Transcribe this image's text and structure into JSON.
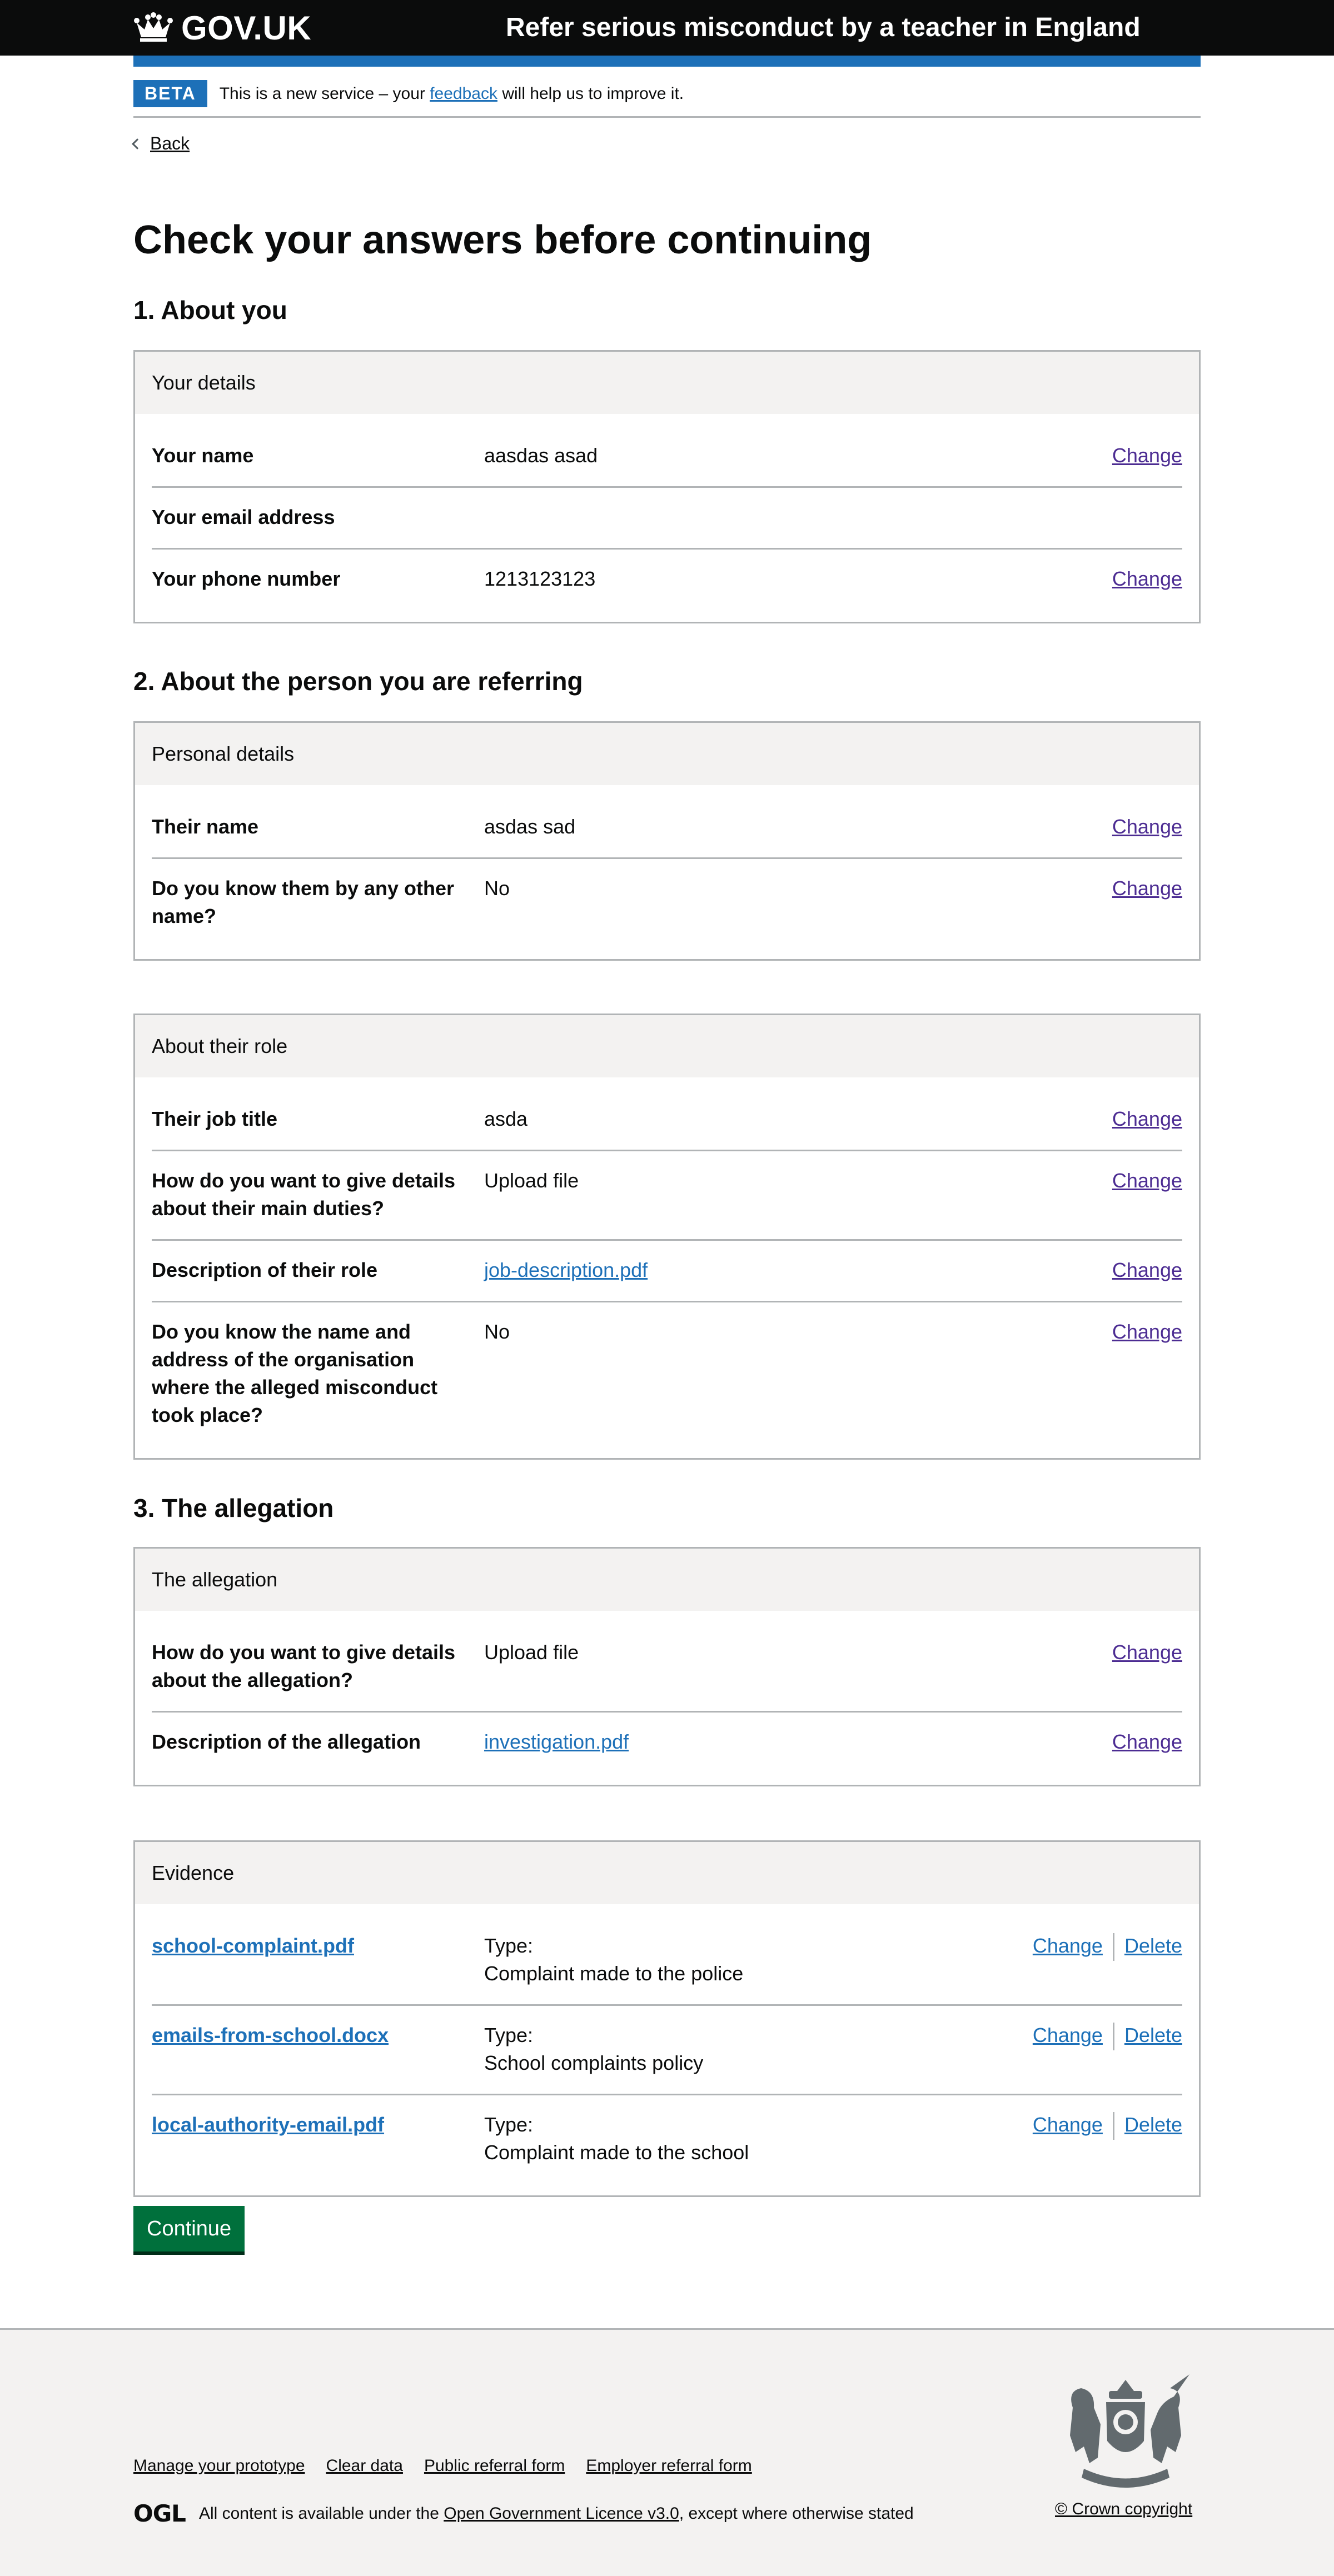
{
  "header": {
    "logo_text": "GOV.UK",
    "service_name": "Refer serious misconduct by a teacher in England"
  },
  "phase": {
    "tag": "BETA",
    "text_before": "This is a new service – your ",
    "link": "feedback",
    "text_after": " will help us to improve it."
  },
  "back_link": "Back",
  "page_title": "Check your answers before continuing",
  "sections": {
    "s1": "1. About you",
    "s2": "2. About the person you are referring",
    "s3": "3. The allegation"
  },
  "cards": {
    "your_details": {
      "title": "Your details",
      "rows": [
        {
          "key": "Your name",
          "value": "aasdas asad",
          "action": "Change"
        },
        {
          "key": "Your email address",
          "value": "",
          "action": ""
        },
        {
          "key": "Your phone number",
          "value": "1213123123",
          "action": "Change"
        }
      ]
    },
    "personal_details": {
      "title": "Personal details",
      "rows": [
        {
          "key": "Their name",
          "value": "asdas sad",
          "action": "Change"
        },
        {
          "key": "Do you know them by any other name?",
          "value": "No",
          "action": "Change"
        }
      ]
    },
    "about_role": {
      "title": "About their role",
      "rows": [
        {
          "key": "Their job title",
          "value": "asda",
          "action": "Change"
        },
        {
          "key": "How do you want to give details about their main duties?",
          "value": "Upload file",
          "action": "Change"
        },
        {
          "key": "Description of their role",
          "value": "job-description.pdf",
          "action": "Change"
        },
        {
          "key": "Do you know the name and address of the organisation where the alleged misconduct took place?",
          "value": "No",
          "action": "Change"
        }
      ]
    },
    "allegation": {
      "title": "The allegation",
      "rows": [
        {
          "key": "How do you want to give details about the allegation?",
          "value": "Upload file",
          "action": "Change"
        },
        {
          "key": "Description of the allegation",
          "value": "investigation.pdf",
          "action": "Change"
        }
      ]
    },
    "evidence": {
      "title": "Evidence",
      "type_label": "Type:",
      "change": "Change",
      "delete": "Delete",
      "rows": [
        {
          "file": "school-complaint.pdf",
          "type": "Complaint made to the police"
        },
        {
          "file": "emails-from-school.docx",
          "type": "School complaints policy"
        },
        {
          "file": "local-authority-email.pdf",
          "type": "Complaint made to the school"
        }
      ]
    }
  },
  "continue_label": "Continue",
  "footer": {
    "links": [
      "Manage your prototype",
      "Clear data",
      "Public referral form",
      "Employer referral form"
    ],
    "ogl": "OGL",
    "licence_before": "All content is available under the ",
    "licence_link": "Open Government Licence v3.0",
    "licence_after": ", except where otherwise stated",
    "copyright": "© Crown copyright"
  },
  "colors": {
    "header": "#0b0c0c",
    "blue": "#1d70b8",
    "visited": "#4c2c92",
    "button": "#00703c",
    "card_head": "#f3f2f1",
    "border": "#b1b4b6"
  }
}
